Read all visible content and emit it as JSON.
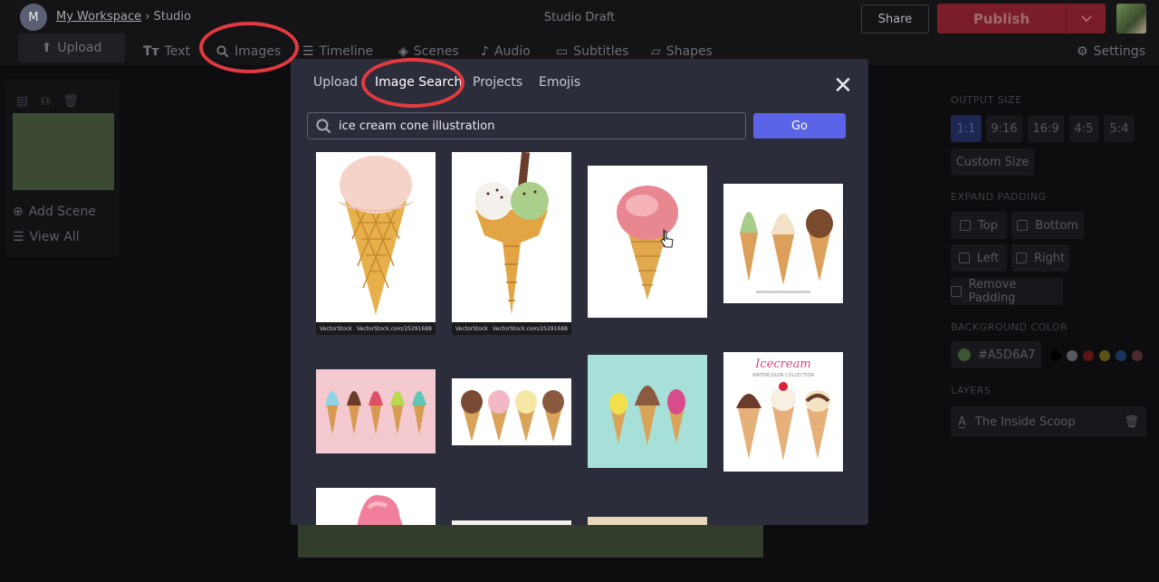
{
  "header": {
    "workspace_initial": "M",
    "workspace_label": "My Workspace",
    "crumb_sep": "›",
    "studio_label": "Studio",
    "title": "Studio Draft",
    "share_label": "Share",
    "publish_label": "Publish"
  },
  "toolbar": {
    "upload": "Upload",
    "text": "Text",
    "images": "Images",
    "timeline": "Timeline",
    "scenes": "Scenes",
    "audio": "Audio",
    "subtitles": "Subtitles",
    "shapes": "Shapes",
    "settings": "Settings"
  },
  "left_panel": {
    "add_scene": "Add Scene",
    "view_all": "View All"
  },
  "right_panel": {
    "output_size_label": "OUTPUT SIZE",
    "sizes": [
      "1:1",
      "9:16",
      "16:9",
      "4:5",
      "5:4"
    ],
    "custom_size": "Custom Size",
    "expand_padding_label": "EXPAND PADDING",
    "top": "Top",
    "bottom": "Bottom",
    "left": "Left",
    "right": "Right",
    "remove_padding": "Remove Padding",
    "background_color_label": "BACKGROUND COLOR",
    "bg_hex": "#A5D6A7",
    "layers_label": "LAYERS",
    "layer_name": "The Inside Scoop"
  },
  "modal": {
    "tabs": [
      "Upload",
      "Image Search",
      "Projects",
      "Emojis"
    ],
    "active_tab": "Image Search",
    "search_value": "ice cream cone illustration",
    "go_label": "Go",
    "watermark_left": "VectorStock",
    "watermark_right": "VectorStock.com/25291688",
    "poster_title": "Icecream",
    "poster_subtitle": "WATERCOLOR COLLECTION"
  },
  "colors": {
    "accent": "#5b63e6",
    "publish": "#7a1d28",
    "annotation": "#e23a3f",
    "swatches": [
      "#000000",
      "#bdbdbd",
      "#c62828",
      "#c0a818",
      "#1e88e5",
      "#e57373"
    ]
  }
}
